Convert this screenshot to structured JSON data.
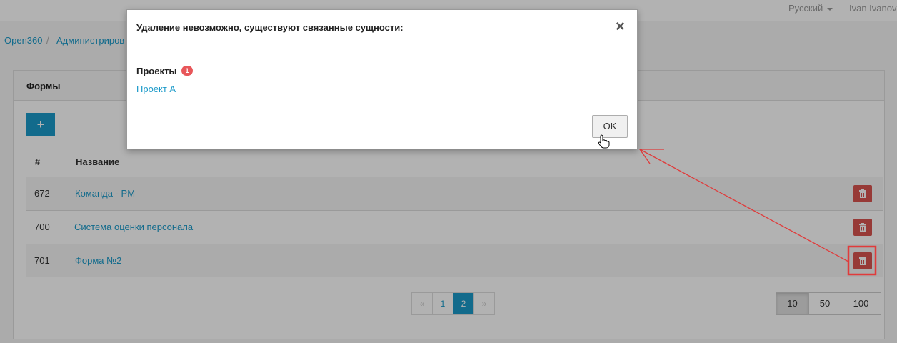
{
  "topbar": {
    "language": "Русский",
    "user": "Ivan Ivanov"
  },
  "breadcrumb": {
    "items": [
      "Open360",
      "Администриров"
    ],
    "separator": "/"
  },
  "panel": {
    "title": "Формы",
    "add_label": "+"
  },
  "table": {
    "headers": {
      "num": "#",
      "name": "Название"
    },
    "rows": [
      {
        "num": "672",
        "name": "Команда - PM"
      },
      {
        "num": "700",
        "name": "Система оценки персонала"
      },
      {
        "num": "701",
        "name": "Форма №2"
      }
    ]
  },
  "pagination": {
    "prev": "«",
    "pages": [
      "1",
      "2"
    ],
    "active_page": "2",
    "next": "»"
  },
  "page_sizes": {
    "options": [
      "10",
      "50",
      "100"
    ],
    "selected": "10"
  },
  "modal": {
    "title": "Удаление невозможно, существуют связанные сущности:",
    "close_glyph": "×",
    "section_label": "Проекты",
    "badge_count": "1",
    "project_link": "Проект А",
    "ok_label": "OK"
  },
  "icons": [
    "trash-icon",
    "close-icon",
    "hand-cursor-icon"
  ],
  "colors": {
    "accent": "#1b9ac9",
    "danger": "#d9534f",
    "badge": "#e8575a",
    "annotation": "#e03b3b"
  }
}
